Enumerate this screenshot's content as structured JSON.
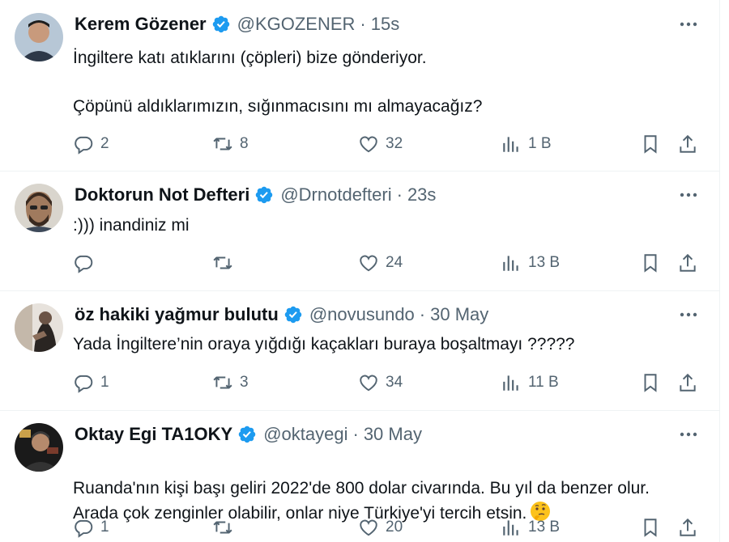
{
  "tweets": [
    {
      "name": "Kerem Gözener",
      "handle": "@KGOZENER",
      "time": "15s",
      "text": "İngiltere katı atıklarını (çöpleri) bize gönderiyor.\n\nÇöpünü aldıklarımızın, sığınmacısını mı almayacağız?",
      "replies": "2",
      "retweets": "8",
      "likes": "32",
      "views": "1 B",
      "avatar_color": "#6d4c3a"
    },
    {
      "name": "Doktorun Not Defteri",
      "handle": "@Drnotdefteri",
      "time": "23s",
      "text": ":))) inandiniz mi",
      "replies": "",
      "retweets": "",
      "likes": "24",
      "views": "13 B",
      "avatar_color": "#5a4a3c"
    },
    {
      "name": "öz hakiki yağmur bulutu",
      "handle": "@novusundo",
      "time": "30 May",
      "text": "Yada İngiltere’nin oraya yığdığı kaçakları buraya boşaltmayı ?????",
      "replies": "1",
      "retweets": "3",
      "likes": "34",
      "views": "11 B",
      "avatar_color": "#8a7f74"
    },
    {
      "name": "Oktay Egi TA1OKY",
      "handle": "@oktayegi",
      "time": "30 May",
      "text": "Ruanda'nın kişi başı geliri 2022'de 800  dolar civarında. Bu yıl da benzer olur. Arada çok zenginler olabilir, onlar niye Türkiye'yi tercih etsin.",
      "emoji": "thinking-face",
      "replies": "1",
      "retweets": "",
      "likes": "20",
      "views": "13 B",
      "avatar_color": "#2b2b2b"
    }
  ],
  "colors": {
    "verified": "#1d9bf0",
    "secondary": "#536471",
    "text": "#0f1419"
  }
}
